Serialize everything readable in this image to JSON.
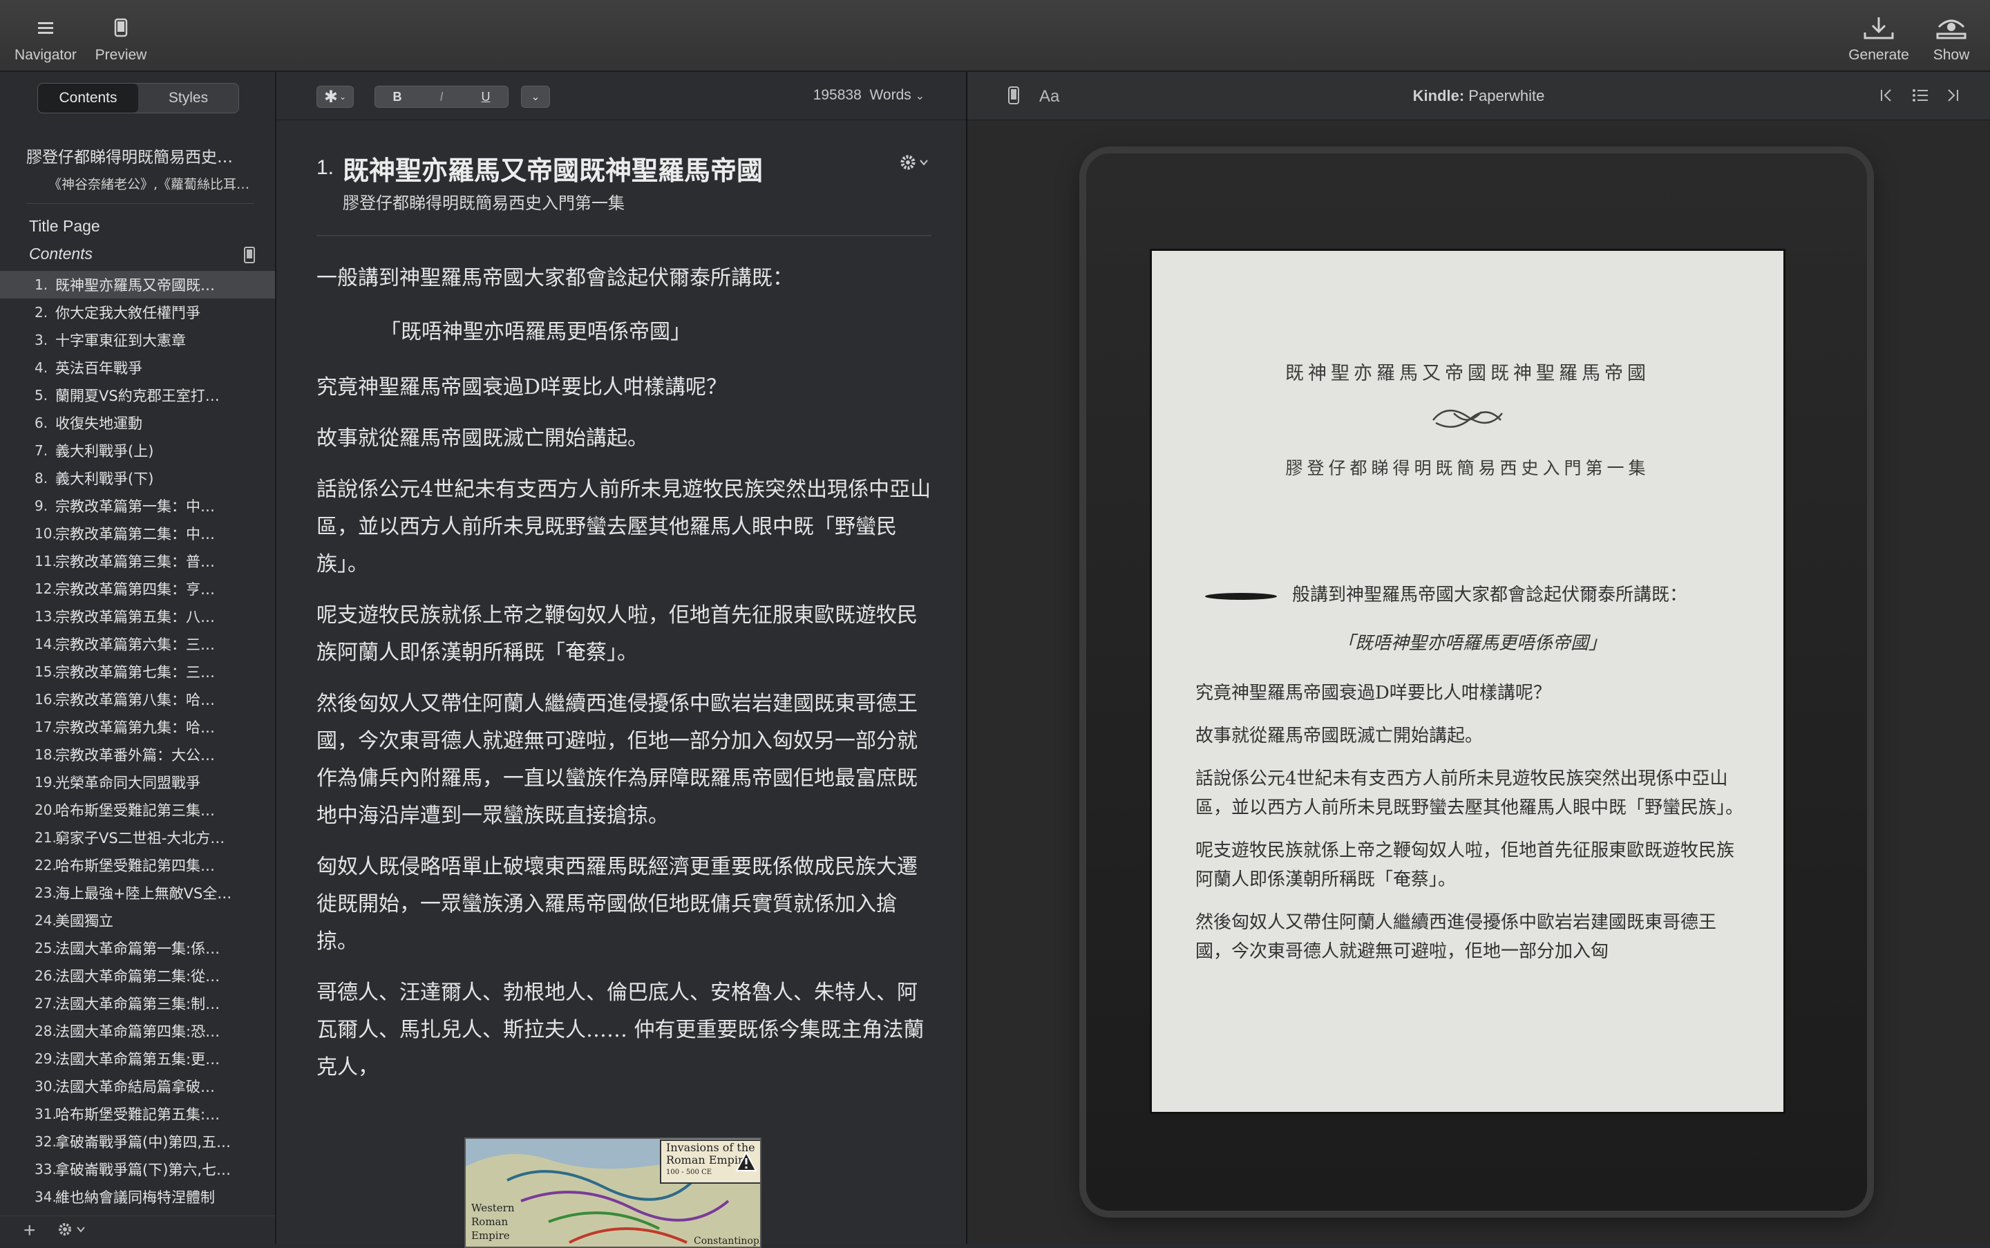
{
  "toolbar": {
    "navigator_label": "Navigator",
    "preview_label": "Preview",
    "generate_label": "Generate",
    "show_label": "Show"
  },
  "sidebar": {
    "tab_contents": "Contents",
    "tab_styles": "Styles",
    "book_title": "膠登仔都睇得明既簡易西史…",
    "book_author": "《神谷奈緒老公》,《蘿蔔絲比耳…",
    "title_page": "Title Page",
    "contents": "Contents",
    "chapters": [
      {
        "num": "1.",
        "title": "既神聖亦羅馬又帝國既…"
      },
      {
        "num": "2.",
        "title": "你大定我大敘任權鬥爭"
      },
      {
        "num": "3.",
        "title": "十字軍東征到大憲章"
      },
      {
        "num": "4.",
        "title": "英法百年戰爭"
      },
      {
        "num": "5.",
        "title": "蘭開夏VS約克郡王室打…"
      },
      {
        "num": "6.",
        "title": "收復失地運動"
      },
      {
        "num": "7.",
        "title": "義大利戰爭(上)"
      },
      {
        "num": "8.",
        "title": "義大利戰爭(下)"
      },
      {
        "num": "9.",
        "title": "宗教改革篇第一集：中…"
      },
      {
        "num": "10.",
        "title": "宗教改革篇第二集：中…"
      },
      {
        "num": "11.",
        "title": "宗教改革篇第三集：普…"
      },
      {
        "num": "12.",
        "title": "宗教改革篇第四集：亨…"
      },
      {
        "num": "13.",
        "title": "宗教改革篇第五集：八…"
      },
      {
        "num": "14.",
        "title": "宗教改革篇第六集：三…"
      },
      {
        "num": "15.",
        "title": "宗教改革篇第七集：三…"
      },
      {
        "num": "16.",
        "title": "宗教改革篇第八集：哈…"
      },
      {
        "num": "17.",
        "title": "宗教改革篇第九集：哈…"
      },
      {
        "num": "18.",
        "title": "宗教改革番外篇：大公…"
      },
      {
        "num": "19.",
        "title": "光榮革命同大同盟戰爭"
      },
      {
        "num": "20.",
        "title": "哈布斯堡受難記第三集…"
      },
      {
        "num": "21.",
        "title": "窮家子VS二世祖-大北方…"
      },
      {
        "num": "22.",
        "title": "哈布斯堡受難記第四集…"
      },
      {
        "num": "23.",
        "title": "海上最強+陸上無敵VS全…"
      },
      {
        "num": "24.",
        "title": "美國獨立"
      },
      {
        "num": "25.",
        "title": "法國大革命篇第一集:係…"
      },
      {
        "num": "26.",
        "title": "法國大革命篇第二集:從…"
      },
      {
        "num": "27.",
        "title": "法國大革命篇第三集:制…"
      },
      {
        "num": "28.",
        "title": "法國大革命篇第四集:恐…"
      },
      {
        "num": "29.",
        "title": "法國大革命篇第五集:更…"
      },
      {
        "num": "30.",
        "title": "法國大革命結局篇拿破…"
      },
      {
        "num": "31.",
        "title": "哈布斯堡受難記第五集:…"
      },
      {
        "num": "32.",
        "title": "拿破崙戰爭篇(中)第四,五…"
      },
      {
        "num": "33.",
        "title": "拿破崙戰爭篇(下)第六,七…"
      },
      {
        "num": "34.",
        "title": "維也納會議同梅特涅體制"
      }
    ]
  },
  "editor": {
    "bold": "B",
    "italic": "I",
    "underline": "U",
    "word_count": "195838",
    "words_label": "Words",
    "chapter_num": "1.",
    "chapter_title": "既神聖亦羅馬又帝國既神聖羅馬帝國",
    "chapter_subtitle": "膠登仔都睇得明既簡易西史入門第一集",
    "paragraphs": {
      "p1": "一般講到神聖羅馬帝國大家都會諗起伏爾泰所講既：",
      "quote": "「既唔神聖亦唔羅馬更唔係帝國」",
      "p2": "究竟神聖羅馬帝國衰過D咩要比人咁樣講呢？",
      "p3": "故事就從羅馬帝國既滅亡開始講起。",
      "p4": "話說係公元4世紀未有支西方人前所未見遊牧民族突然出現係中亞山區，並以西方人前所未見既野蠻去壓其他羅馬人眼中既「野蠻民族」。",
      "p5": "呢支遊牧民族就係上帝之鞭匈奴人啦，佢地首先征服東歐既遊牧民族阿蘭人即係漢朝所稱既「奄蔡」。",
      "p6": "然後匈奴人又帶住阿蘭人繼續西進侵擾係中歐岩岩建國既東哥德王國，今次東哥德人就避無可避啦，佢地一部分加入匈奴另一部分就作為傭兵內附羅馬，一直以蠻族作為屏障既羅馬帝國佢地最富庶既地中海沿岸遭到一眾蠻族既直接搶掠。",
      "p7": "匈奴人既侵略唔單止破壞東西羅馬既經濟更重要既係做成民族大遷徙既開始，一眾蠻族湧入羅馬帝國做佢地既傭兵實質就係加入搶掠。",
      "p8": "哥德人、汪達爾人、勃根地人、倫巴底人、安格魯人、朱特人、阿瓦爾人、馬扎兒人、斯拉夫人…… 仲有更重要既係今集既主角法蘭克人，"
    },
    "figure": {
      "title": "Invasions of the Roman Empire",
      "dates": "100 - 500 CE",
      "label_western": "Western Roman Empire",
      "label_const": "Constantinople"
    }
  },
  "preview": {
    "device_brand": "Kindle:",
    "device_model": "Paperwhite",
    "aa": "Aa",
    "page": {
      "title": "既神聖亦羅馬又帝國既神聖羅馬帝國",
      "subtitle": "膠登仔都睇得明既簡易西史入門第一集",
      "first": "般講到神聖羅馬帝國大家都會諗起伏爾泰所講既：",
      "quote": "「既唔神聖亦唔羅馬更唔係帝國」",
      "p2": "究竟神聖羅馬帝國衰過D咩要比人咁樣講呢？",
      "p3": "故事就從羅馬帝國既滅亡開始講起。",
      "p4": "話說係公元4世紀未有支西方人前所未見遊牧民族突然出現係中亞山區，並以西方人前所未見既野蠻去壓其他羅馬人眼中既「野蠻民族」。",
      "p5": "呢支遊牧民族就係上帝之鞭匈奴人啦，佢地首先征服東歐既遊牧民族阿蘭人即係漢朝所稱既「奄蔡」。",
      "p6": "然後匈奴人又帶住阿蘭人繼續西進侵擾係中歐岩岩建國既東哥德王國，今次東哥德人就避無可避啦，佢地一部分加入匈"
    }
  }
}
